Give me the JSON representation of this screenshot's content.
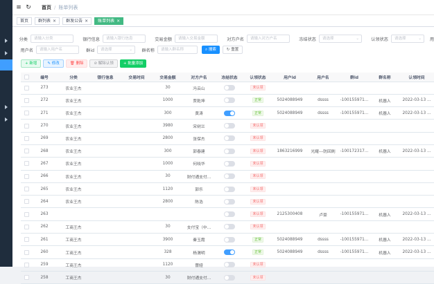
{
  "header": {
    "home": "首页",
    "sep": "/",
    "current": "账单列表"
  },
  "tabs": [
    {
      "label": "首页"
    },
    {
      "label": "群列表"
    },
    {
      "label": "群发公告"
    },
    {
      "label": "账单列表"
    }
  ],
  "filters": {
    "row1": [
      {
        "label": "分类",
        "placeholder": "请输入分类"
      },
      {
        "label": "银行信息",
        "placeholder": "请输入银行信息"
      },
      {
        "label": "交易金额",
        "placeholder": "请输入交易金额"
      },
      {
        "label": "对方户名",
        "placeholder": "请输入对方户名"
      },
      {
        "label": "冻结状态",
        "placeholder": "请选择"
      },
      {
        "label": "认领状态",
        "placeholder": "请选择"
      },
      {
        "label": "用户Id",
        "placeholder": ""
      }
    ],
    "row2": [
      {
        "label": "用户名",
        "placeholder": "请输入用户名"
      },
      {
        "label": "群id",
        "placeholder": "请选择"
      },
      {
        "label": "群名称",
        "placeholder": "请输入群名称"
      }
    ],
    "search_label": "搜索",
    "reset_label": "重置"
  },
  "toolbar": {
    "add": "+ 新增",
    "edit": "✎ 修改",
    "delete": "🗑 删除",
    "unclaim": "⊘ 解除认领",
    "batch": "+ 批量添加"
  },
  "table": {
    "headers": [
      "",
      "编号",
      "分类",
      "银行信息",
      "交易时间",
      "交易金额",
      "对方户名",
      "冻结状态",
      "认领状态",
      "用户id",
      "用户名",
      "群id",
      "群名称",
      "认领时间"
    ],
    "rows": [
      {
        "id": "273",
        "cat": "农业王杰",
        "bank": "",
        "time": "",
        "amount": "30",
        "name": "冯云山",
        "frozen": false,
        "claim": "未认领",
        "claim_ok": false,
        "uid": "",
        "uname": "",
        "gid": "",
        "gname": "",
        "ctime": ""
      },
      {
        "id": "272",
        "cat": "农业王杰",
        "bank": "",
        "time": "",
        "amount": "1000",
        "name": "贾乾坤",
        "frozen": false,
        "claim": "正常",
        "claim_ok": true,
        "uid": "5024088949",
        "uname": "dssss",
        "gid": "-100155971...",
        "gname": "机器人",
        "ctime": "2022-03-13 ..."
      },
      {
        "id": "271",
        "cat": "农业王杰",
        "bank": "",
        "time": "",
        "amount": "300",
        "name": "黄涛",
        "frozen": true,
        "claim": "正常",
        "claim_ok": true,
        "uid": "5024088949",
        "uname": "dssss",
        "gid": "-100155971...",
        "gname": "机器人",
        "ctime": "2022-03-13 ..."
      },
      {
        "id": "270",
        "cat": "农业王杰",
        "bank": "",
        "time": "",
        "amount": "3980",
        "name": "宋树兰",
        "frozen": false,
        "claim": "未认领",
        "claim_ok": false,
        "uid": "",
        "uname": "",
        "gid": "",
        "gname": "",
        "ctime": ""
      },
      {
        "id": "269",
        "cat": "农业王杰",
        "bank": "",
        "time": "",
        "amount": "2800",
        "name": "张保杰",
        "frozen": false,
        "claim": "未认领",
        "claim_ok": false,
        "uid": "",
        "uname": "",
        "gid": "",
        "gname": "",
        "ctime": ""
      },
      {
        "id": "268",
        "cat": "农业王杰",
        "bank": "",
        "time": "",
        "amount": "300",
        "name": "郭春建",
        "frozen": false,
        "claim": "未认领",
        "claim_ok": false,
        "uid": "1863216999",
        "uname": "光耀---防回刷",
        "gid": "-100172317...",
        "gname": "机器人",
        "ctime": "2022-03-13 ..."
      },
      {
        "id": "267",
        "cat": "农业王杰",
        "bank": "",
        "time": "",
        "amount": "1000",
        "name": "何晓华",
        "frozen": false,
        "claim": "未认领",
        "claim_ok": false,
        "uid": "",
        "uname": "",
        "gid": "",
        "gname": "",
        "ctime": ""
      },
      {
        "id": "266",
        "cat": "农业王杰",
        "bank": "",
        "time": "",
        "amount": "30",
        "name": "财付通支付...",
        "frozen": false,
        "claim": "未认领",
        "claim_ok": false,
        "uid": "",
        "uname": "",
        "gid": "",
        "gname": "",
        "ctime": ""
      },
      {
        "id": "265",
        "cat": "农业王杰",
        "bank": "",
        "time": "",
        "amount": "1120",
        "name": "郭乐",
        "frozen": false,
        "claim": "未认领",
        "claim_ok": false,
        "uid": "",
        "uname": "",
        "gid": "",
        "gname": "",
        "ctime": ""
      },
      {
        "id": "264",
        "cat": "农业王杰",
        "bank": "",
        "time": "",
        "amount": "2800",
        "name": "陈浩",
        "frozen": false,
        "claim": "未认领",
        "claim_ok": false,
        "uid": "",
        "uname": "",
        "gid": "",
        "gname": "",
        "ctime": ""
      },
      {
        "id": "263",
        "cat": "",
        "bank": "",
        "time": "",
        "amount": "",
        "name": "",
        "frozen": false,
        "claim": "未认领",
        "claim_ok": false,
        "uid": "2125300408",
        "uname": "卢豪",
        "gid": "-100155971...",
        "gname": "机器人",
        "ctime": "2022-03-13 ..."
      },
      {
        "id": "262",
        "cat": "工商王杰",
        "bank": "",
        "time": "",
        "amount": "30",
        "name": "支付宝（中...",
        "frozen": false,
        "claim": "未认领",
        "claim_ok": false,
        "uid": "",
        "uname": "",
        "gid": "",
        "gname": "",
        "ctime": ""
      },
      {
        "id": "261",
        "cat": "工商王杰",
        "bank": "",
        "time": "",
        "amount": "3900",
        "name": "秦玉霞",
        "frozen": false,
        "claim": "正常",
        "claim_ok": true,
        "uid": "5024088949",
        "uname": "dssss",
        "gid": "-100155971...",
        "gname": "机器人",
        "ctime": "2022-03-13 ..."
      },
      {
        "id": "260",
        "cat": "工商王杰",
        "bank": "",
        "time": "",
        "amount": "328",
        "name": "杨渭明",
        "frozen": true,
        "claim": "正常",
        "claim_ok": true,
        "uid": "5024088949",
        "uname": "dssss",
        "gid": "-100155971...",
        "gname": "机器人",
        "ctime": "2022-03-13 ..."
      },
      {
        "id": "259",
        "cat": "工商王杰",
        "bank": "",
        "time": "",
        "amount": "1120",
        "name": "蕾娅",
        "frozen": false,
        "claim": "未认领",
        "claim_ok": false,
        "uid": "",
        "uname": "",
        "gid": "",
        "gname": "",
        "ctime": ""
      },
      {
        "id": "258",
        "cat": "工商王杰",
        "bank": "",
        "time": "",
        "amount": "30",
        "name": "财付通支付...",
        "frozen": false,
        "claim": "未认领",
        "claim_ok": false,
        "uid": "",
        "uname": "",
        "gid": "",
        "gname": "",
        "ctime": ""
      }
    ]
  }
}
